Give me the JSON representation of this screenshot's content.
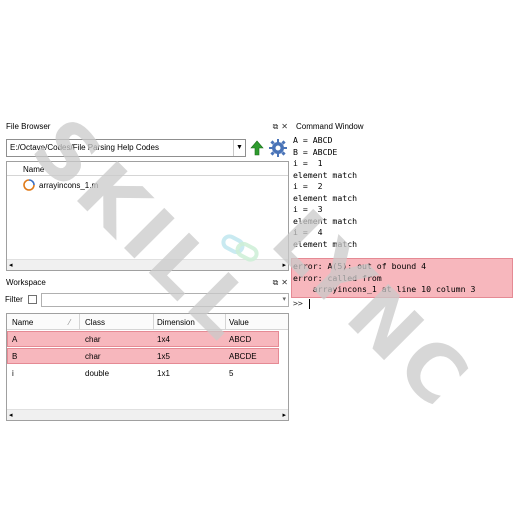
{
  "file_browser": {
    "title": "File Browser",
    "undock_icon": "⧉",
    "close_icon": "✕",
    "path": "E:/Octave/Codes/File Parsing Help Codes",
    "column_name": "Name",
    "files": [
      {
        "name": "arrayincons_1.m",
        "icon": "octave-script-icon"
      }
    ]
  },
  "workspace": {
    "title": "Workspace",
    "undock_icon": "⧉",
    "close_icon": "✕",
    "filter_label": "Filter",
    "columns": [
      "Name",
      "Class",
      "Dimension",
      "Value"
    ],
    "rows": [
      {
        "name": "A",
        "class": "char",
        "dimension": "1x4",
        "value": "ABCD",
        "highlighted": true
      },
      {
        "name": "B",
        "class": "char",
        "dimension": "1x5",
        "value": "ABCDE",
        "highlighted": true
      },
      {
        "name": "i",
        "class": "double",
        "dimension": "1x1",
        "value": "5",
        "highlighted": false
      }
    ]
  },
  "command_window": {
    "title": "Command Window",
    "lines": [
      "A = ABCD",
      "B = ABCDE",
      "i =  1",
      "element match",
      "i =  2",
      "element match",
      "i =  3",
      "element match",
      "i =  4",
      "element match",
      "error: A(5): out of bound 4",
      "error: called from",
      "    arrayincons_1 at line 10 column 3",
      ">> "
    ]
  },
  "watermark": {
    "text_top": "SKILL",
    "text_bottom": "LYNC",
    "color": "#c9c9c9"
  },
  "colors": {
    "error_highlight": "#f7b7bd",
    "error_border": "#e58a94"
  }
}
